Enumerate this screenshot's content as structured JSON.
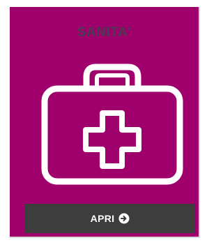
{
  "card": {
    "title": "SANITA'",
    "icon": "first-aid-kit-icon",
    "colors": {
      "background": "#a0006b",
      "title": "#4a3a52",
      "icon_stroke": "#ffffff",
      "button_background": "#3d3d3d",
      "button_text": "#ffffff"
    }
  },
  "button": {
    "label": "APRI",
    "icon": "arrow-right-circle-icon"
  }
}
